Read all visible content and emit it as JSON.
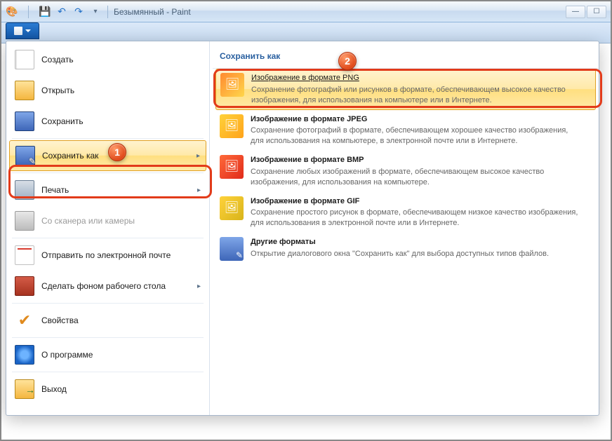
{
  "window": {
    "title": "Безымянный - Paint"
  },
  "qat": {
    "save_tooltip": "Сохранить",
    "undo_tooltip": "Отменить",
    "redo_tooltip": "Вернуть"
  },
  "file_menu": {
    "items": [
      {
        "label": "Создать"
      },
      {
        "label": "Открыть"
      },
      {
        "label": "Сохранить"
      },
      {
        "label": "Сохранить как",
        "has_submenu": true,
        "highlighted": true
      },
      {
        "label": "Печать",
        "has_submenu": true
      },
      {
        "label": "Со сканера или камеры",
        "disabled": true
      },
      {
        "label": "Отправить по электронной почте"
      },
      {
        "label": "Сделать фоном рабочего стола",
        "has_submenu": true
      },
      {
        "label": "Свойства"
      },
      {
        "label": "О программе"
      },
      {
        "label": "Выход"
      }
    ]
  },
  "saveas_panel": {
    "header": "Сохранить как",
    "formats": [
      {
        "title": "Изображение в формате PNG",
        "desc": "Сохранение фотографий или рисунков в формате, обеспечивающем высокое качество изображения, для использования на компьютере или в Интернете.",
        "highlighted": true
      },
      {
        "title": "Изображение в формате JPEG",
        "desc": "Сохранение фотографий в формате, обеспечивающем хорошее качество изображения, для использования на компьютере, в электронной почте или в Интернете."
      },
      {
        "title": "Изображение в формате BMP",
        "desc": "Сохранение любых изображений в формате, обеспечивающем высокое качество изображения, для использования на компьютере."
      },
      {
        "title": "Изображение в формате GIF",
        "desc": "Сохранение простого рисунок в формате, обеспечивающем низкое качество изображения, для использования в электронной почте или в Интернете."
      },
      {
        "title": "Другие форматы",
        "desc": "Открытие диалогового окна \"Сохранить как\" для выбора доступных типов файлов."
      }
    ]
  },
  "callouts": {
    "one": "1",
    "two": "2"
  }
}
